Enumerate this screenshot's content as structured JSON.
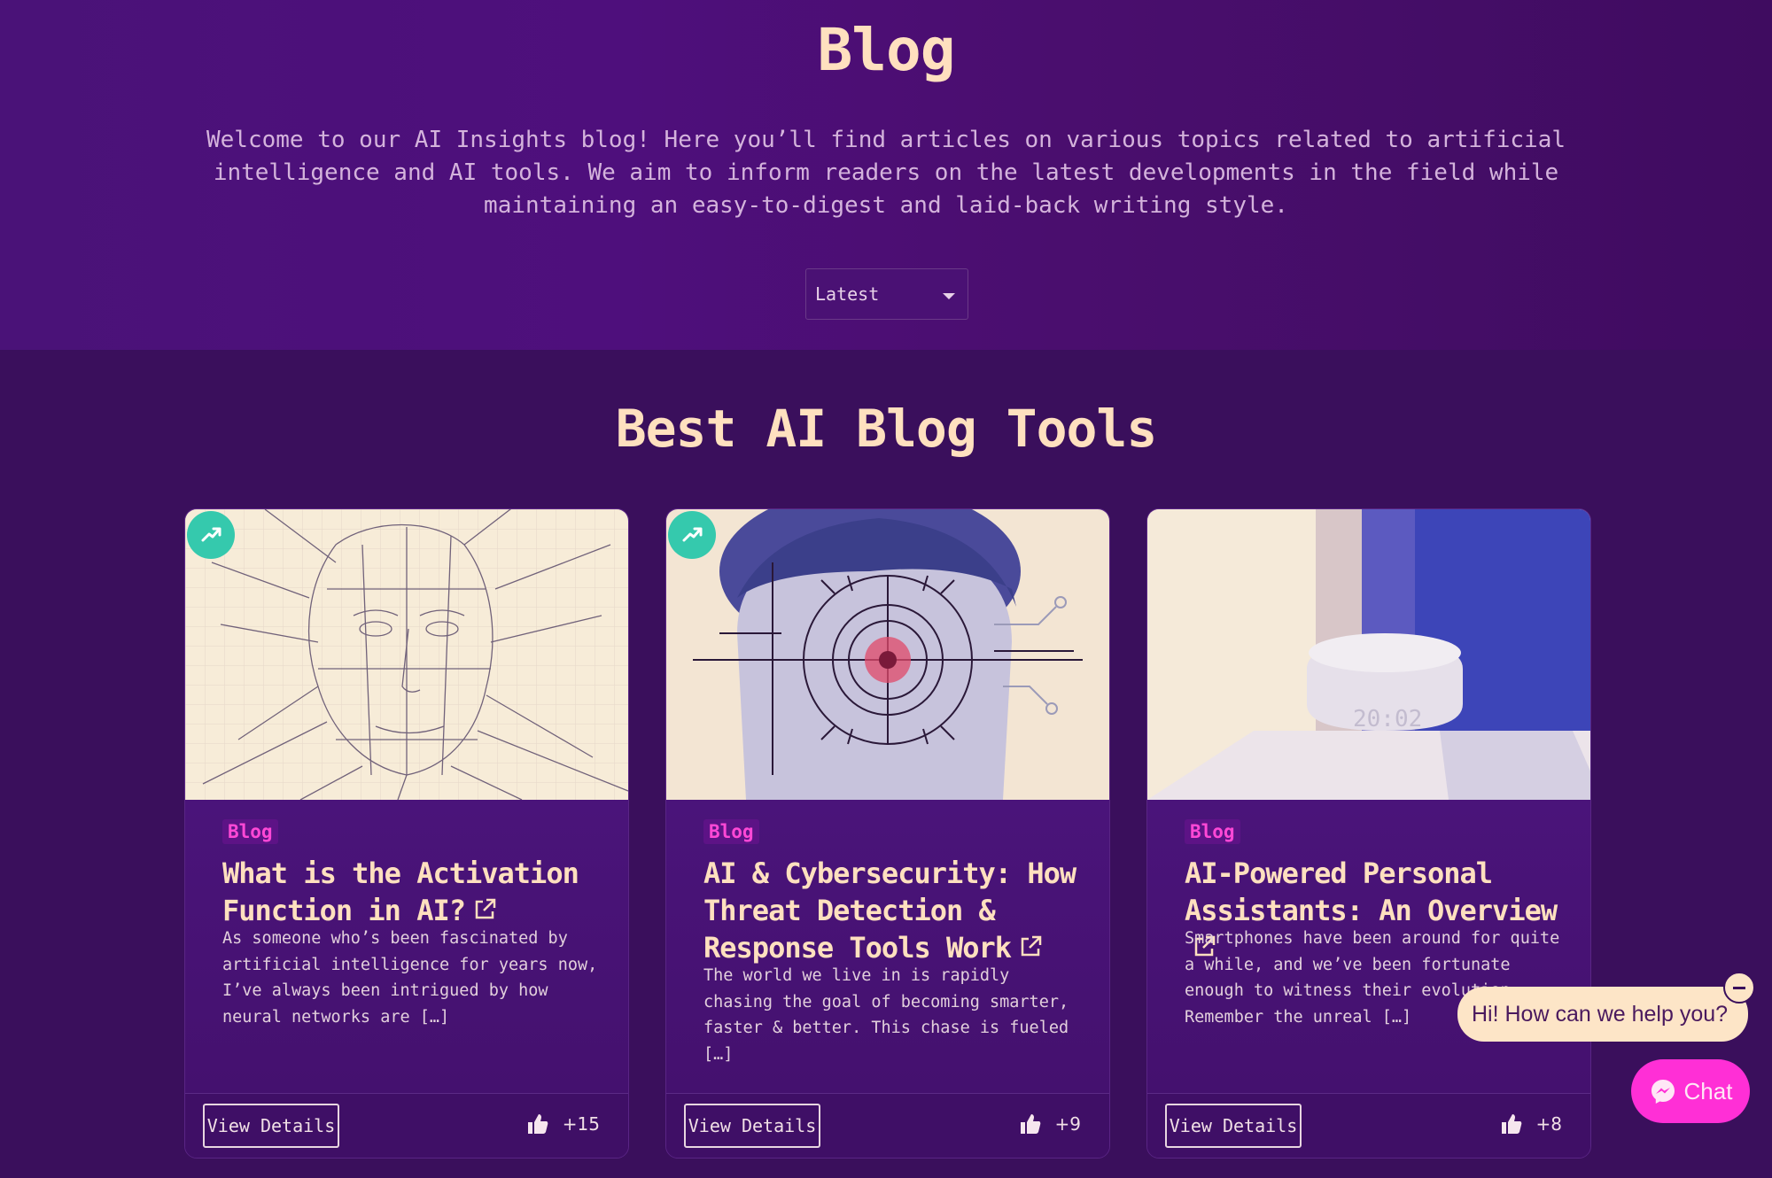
{
  "hero": {
    "title": "Blog",
    "description": "Welcome to our AI Insights blog! Here you’ll find articles on various topics related to artificial intelligence and AI tools. We aim to inform readers on the latest developments in the field while maintaining an easy-to-digest and laid-back writing style.",
    "sort_value": "Latest"
  },
  "section": {
    "title": "Best AI Blog Tools"
  },
  "cards": [
    {
      "tag": "Blog",
      "title": "What is the Activation Function in AI?",
      "excerpt": "As someone who’s been fascinated by artificial intelligence for years now, I’ve always been intrigued by how neural networks are […]",
      "button": "View Details",
      "likes": "+15"
    },
    {
      "tag": "Blog",
      "title": "AI & Cybersecurity: How Threat Detection & Response Tools Work",
      "excerpt": "The world we live in is rapidly chasing the goal of becoming smarter, faster & better. This chase is fueled […]",
      "button": "View Details",
      "likes": "+9"
    },
    {
      "tag": "Blog",
      "title": "AI-Powered Personal Assistants: An Overview",
      "excerpt": "Smartphones have been around for quite a while, and we’ve been fortunate enough to witness their evolution. Remember the unreal […]",
      "button": "View Details",
      "likes": "+8"
    }
  ],
  "chat": {
    "greeting": "Hi! How can we help you?",
    "button": "Chat"
  },
  "colors": {
    "accent": "#ff2fd6",
    "teal": "#35c9ad",
    "title": "#ffe0bf"
  }
}
